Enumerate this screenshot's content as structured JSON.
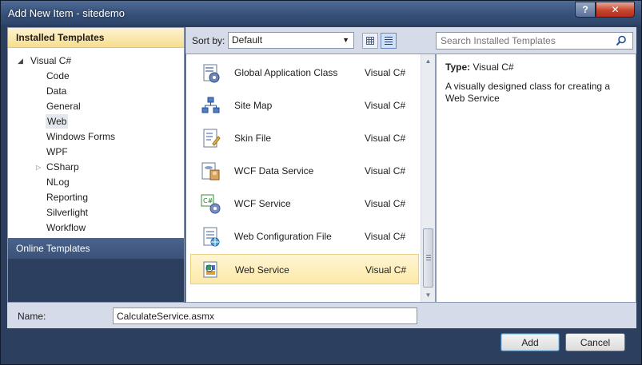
{
  "window": {
    "title": "Add New Item - sitedemo"
  },
  "left_panel": {
    "installed_header": "Installed Templates",
    "tree_root": "Visual C#",
    "items": [
      {
        "label": "Code",
        "selected": false,
        "expandable": false
      },
      {
        "label": "Data",
        "selected": false,
        "expandable": false
      },
      {
        "label": "General",
        "selected": false,
        "expandable": false
      },
      {
        "label": "Web",
        "selected": true,
        "expandable": false
      },
      {
        "label": "Windows Forms",
        "selected": false,
        "expandable": false
      },
      {
        "label": "WPF",
        "selected": false,
        "expandable": false
      },
      {
        "label": "CSharp",
        "selected": false,
        "expandable": true
      },
      {
        "label": "NLog",
        "selected": false,
        "expandable": false
      },
      {
        "label": "Reporting",
        "selected": false,
        "expandable": false
      },
      {
        "label": "Silverlight",
        "selected": false,
        "expandable": false
      },
      {
        "label": "Workflow",
        "selected": false,
        "expandable": false
      }
    ],
    "online_header": "Online Templates"
  },
  "sort": {
    "label": "Sort by:",
    "value": "Default"
  },
  "templates": [
    {
      "name": "Global Application Class",
      "language": "Visual C#",
      "icon": "global-application-class-icon",
      "selected": false
    },
    {
      "name": "Site Map",
      "language": "Visual C#",
      "icon": "site-map-icon",
      "selected": false
    },
    {
      "name": "Skin File",
      "language": "Visual C#",
      "icon": "skin-file-icon",
      "selected": false
    },
    {
      "name": "WCF Data Service",
      "language": "Visual C#",
      "icon": "wcf-data-service-icon",
      "selected": false
    },
    {
      "name": "WCF Service",
      "language": "Visual C#",
      "icon": "wcf-service-icon",
      "selected": false
    },
    {
      "name": "Web Configuration File",
      "language": "Visual C#",
      "icon": "web-configuration-file-icon",
      "selected": false
    },
    {
      "name": "Web Service",
      "language": "Visual C#",
      "icon": "web-service-icon",
      "selected": true
    }
  ],
  "search": {
    "placeholder": "Search Installed Templates"
  },
  "description": {
    "type_label": "Type:",
    "type_value": "Visual C#",
    "text": "A visually designed class for creating a Web Service"
  },
  "name_field": {
    "label": "Name:",
    "value": "CalculateService.asmx"
  },
  "buttons": {
    "add": "Add",
    "cancel": "Cancel"
  },
  "colors": {
    "selection": "#fce9a8",
    "installed_header": "#f7dd8e",
    "frame": "#2d3f5e"
  }
}
